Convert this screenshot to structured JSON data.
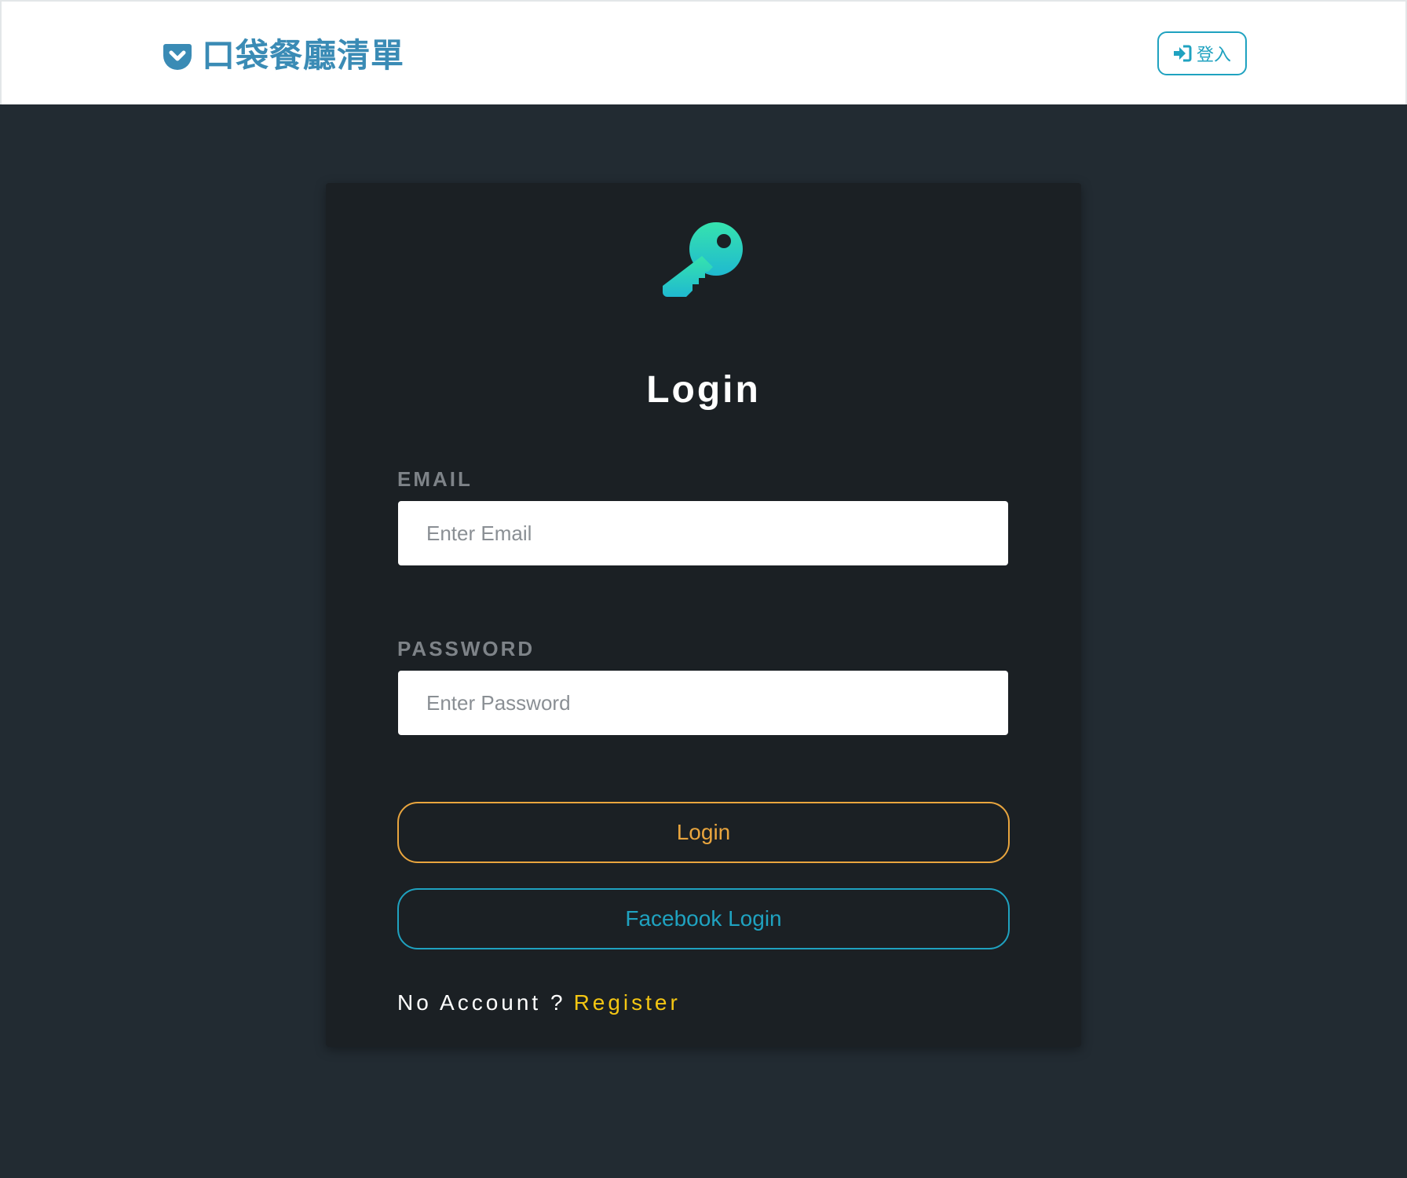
{
  "navbar": {
    "brand_title": "口袋餐廳清單",
    "brand_icon": "pocket-icon",
    "login_label": "登入",
    "login_icon": "sign-in-icon"
  },
  "card": {
    "icon": "key-icon",
    "title": "Login",
    "email": {
      "label": "EMAIL",
      "placeholder": "Enter Email",
      "value": ""
    },
    "password": {
      "label": "PASSWORD",
      "placeholder": "Enter Password",
      "value": ""
    },
    "login_button": "Login",
    "facebook_button": "Facebook Login",
    "register_prompt": "No Account ?",
    "register_link": "Register"
  },
  "colors": {
    "page_background": "#222b32",
    "card_background": "#1b2024",
    "brand": "#3a8bb5",
    "accent_teal": "#1fa2c0",
    "login_orange": "#e9a53e",
    "register_yellow": "#f4c613",
    "key_gradient_top": "#36e3ae",
    "key_gradient_bottom": "#1fb9d0"
  }
}
